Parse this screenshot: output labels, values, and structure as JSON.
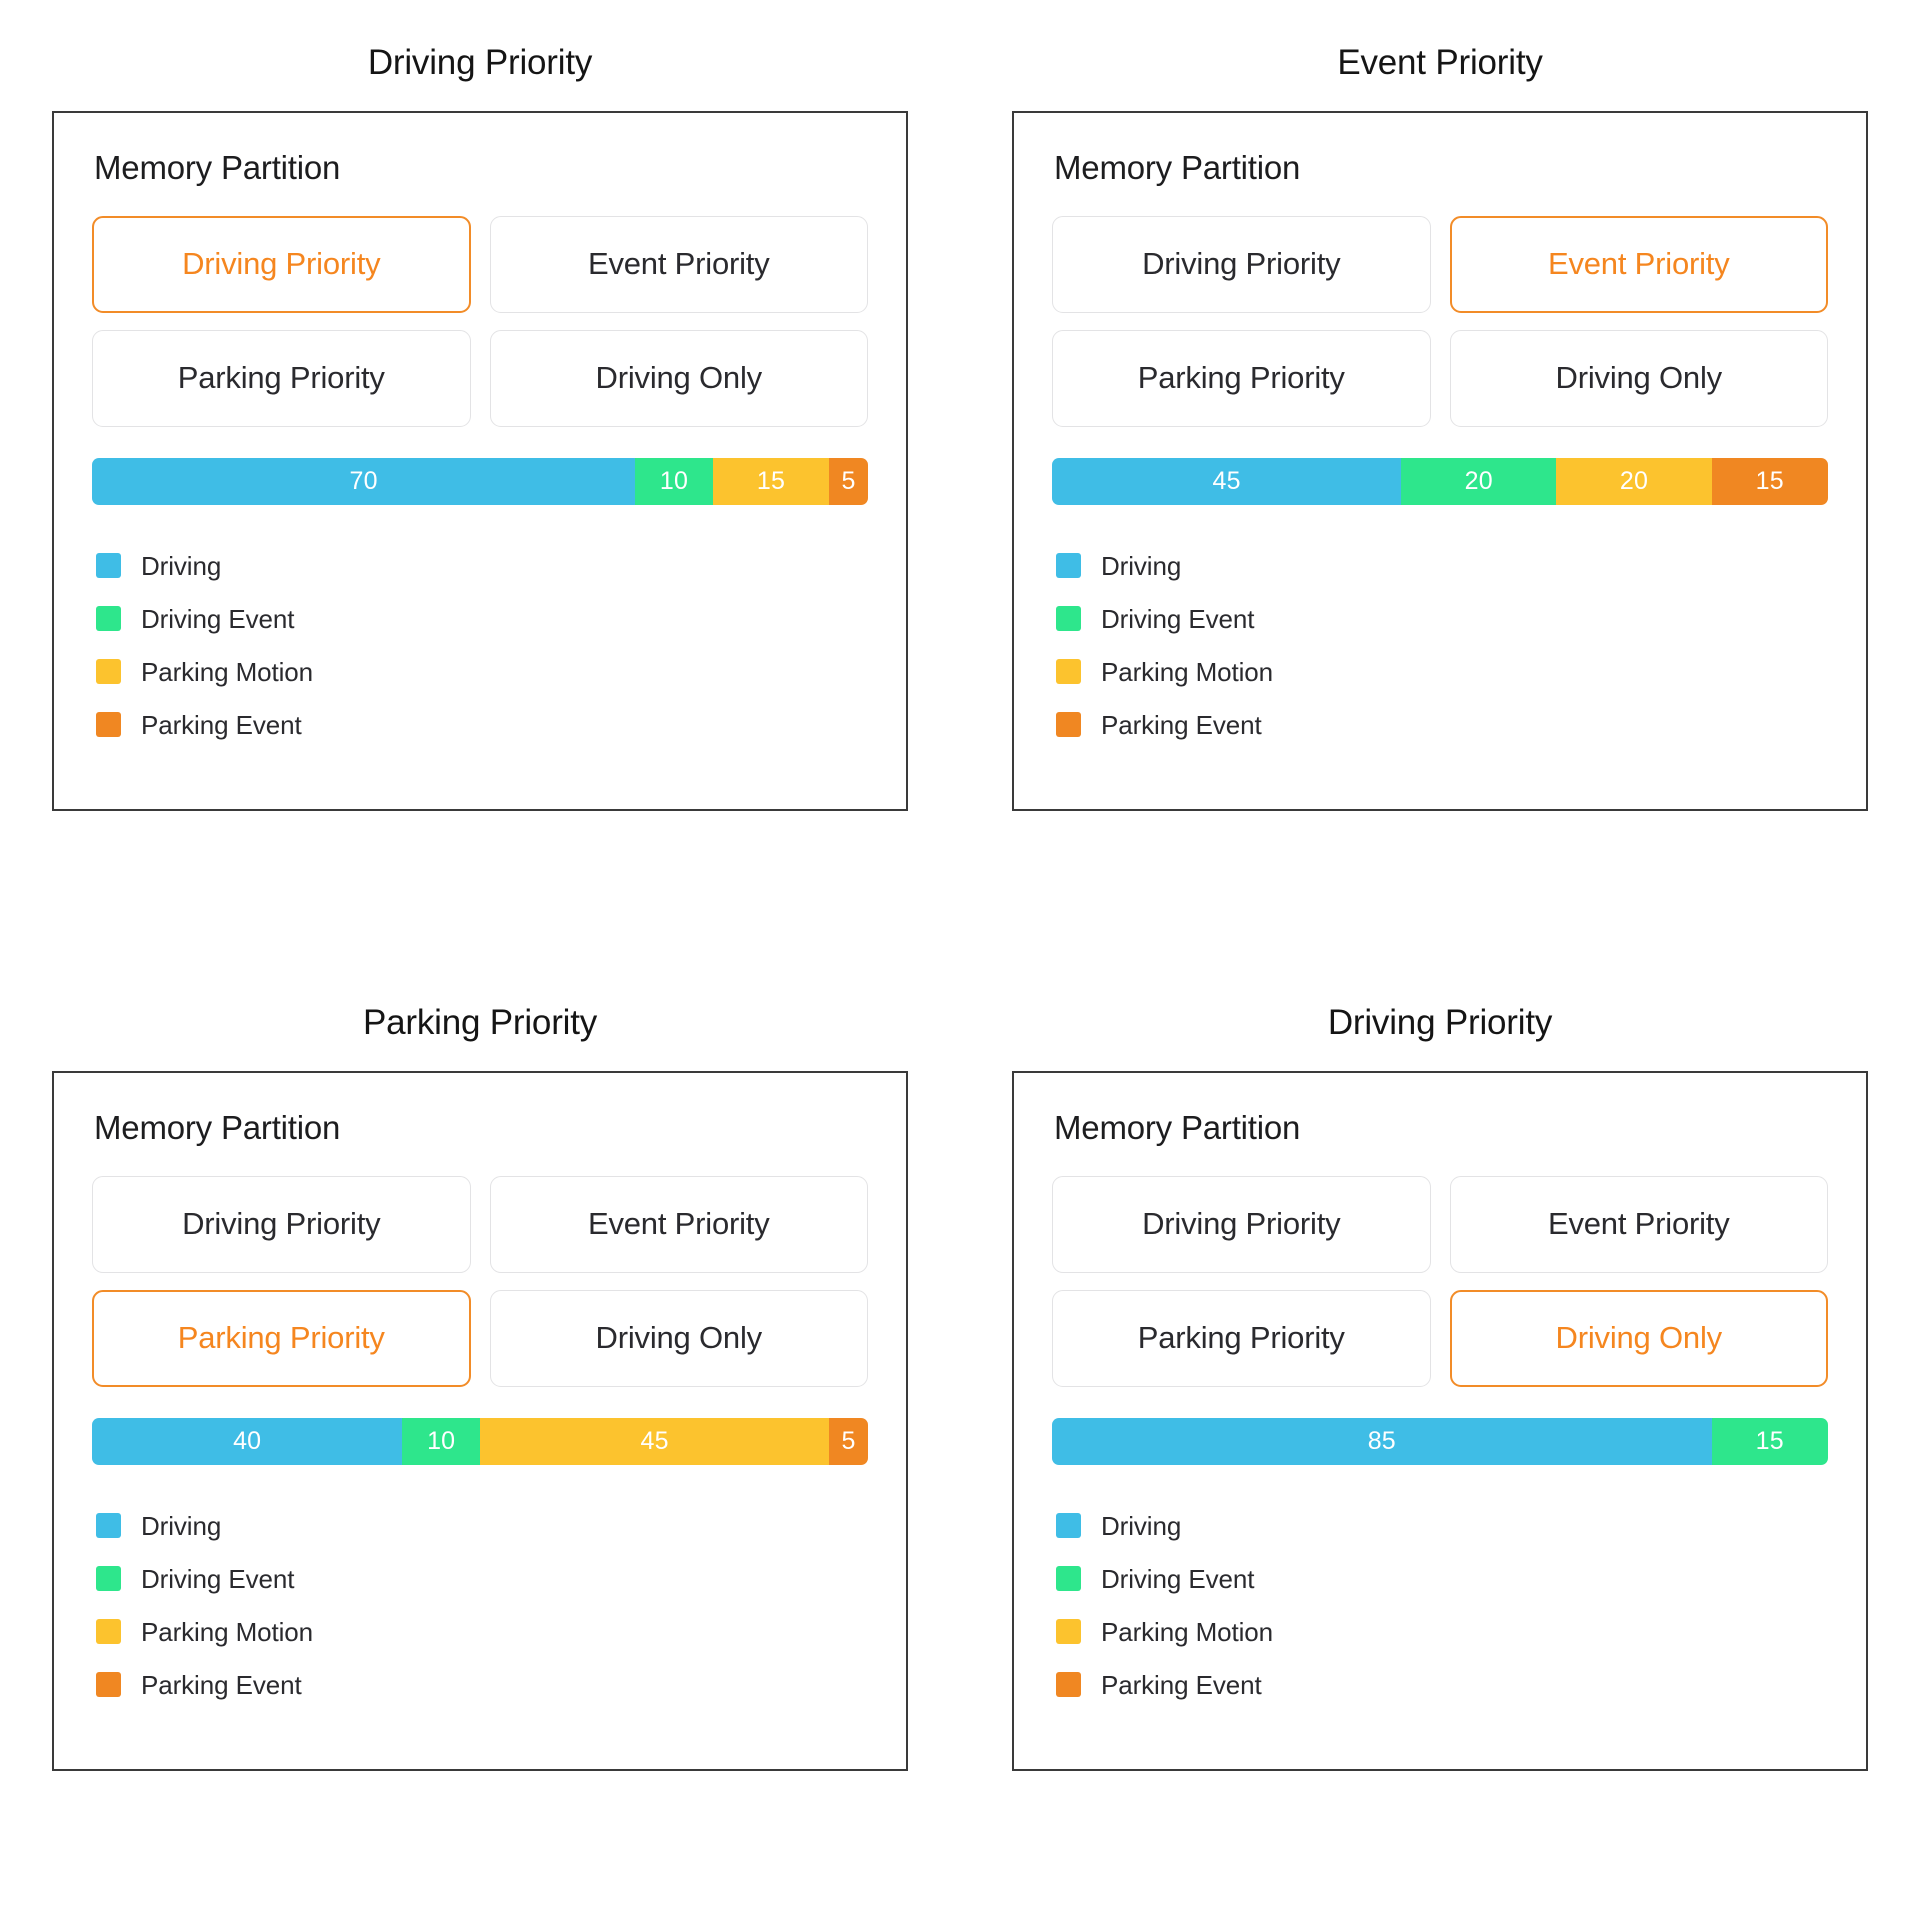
{
  "colors": {
    "driving": "#3FBDE6",
    "driving_event": "#2EE68C",
    "parking_motion": "#FCC32E",
    "parking_event": "#F08722",
    "accent_orange": "#F5861F",
    "panel_border": "#3A3A3A",
    "button_border": "#E3E3E5",
    "text": "#2A2A2E"
  },
  "legend": [
    {
      "label": "Driving",
      "color": "#3FBDE6",
      "key": "driving"
    },
    {
      "label": "Driving Event",
      "color": "#2EE68C",
      "key": "driving_event"
    },
    {
      "label": "Parking Motion",
      "color": "#FCC32E",
      "key": "parking_motion"
    },
    {
      "label": "Parking Event",
      "color": "#F08722",
      "key": "parking_event"
    }
  ],
  "panel_heading": "Memory Partition",
  "mode_buttons": [
    "Driving Priority",
    "Event Priority",
    "Parking Priority",
    "Driving Only"
  ],
  "panels": [
    {
      "title": "Driving Priority",
      "heading": "Memory Partition",
      "selected_button": "Driving Priority",
      "buttons": [
        {
          "label": "Driving Priority",
          "selected": true
        },
        {
          "label": "Event Priority",
          "selected": false
        },
        {
          "label": "Parking Priority",
          "selected": false
        },
        {
          "label": "Driving Only",
          "selected": false
        }
      ],
      "segments": [
        {
          "label": "70",
          "value": 70,
          "color": "#3FBDE6",
          "name": "Driving"
        },
        {
          "label": "10",
          "value": 10,
          "color": "#2EE68C",
          "name": "Driving Event"
        },
        {
          "label": "15",
          "value": 15,
          "color": "#FCC32E",
          "name": "Parking Motion"
        },
        {
          "label": "5",
          "value": 5,
          "color": "#F08722",
          "name": "Parking Event"
        }
      ]
    },
    {
      "title": "Event Priority",
      "heading": "Memory Partition",
      "selected_button": "Event Priority",
      "buttons": [
        {
          "label": "Driving Priority",
          "selected": false
        },
        {
          "label": "Event Priority",
          "selected": true
        },
        {
          "label": "Parking Priority",
          "selected": false
        },
        {
          "label": "Driving Only",
          "selected": false
        }
      ],
      "segments": [
        {
          "label": "45",
          "value": 45,
          "color": "#3FBDE6",
          "name": "Driving"
        },
        {
          "label": "20",
          "value": 20,
          "color": "#2EE68C",
          "name": "Driving Event"
        },
        {
          "label": "20",
          "value": 20,
          "color": "#FCC32E",
          "name": "Parking Motion"
        },
        {
          "label": "15",
          "value": 15,
          "color": "#F08722",
          "name": "Parking Event"
        }
      ]
    },
    {
      "title": "Parking Priority",
      "heading": "Memory Partition",
      "selected_button": "Parking Priority",
      "buttons": [
        {
          "label": "Driving Priority",
          "selected": false
        },
        {
          "label": "Event Priority",
          "selected": false
        },
        {
          "label": "Parking Priority",
          "selected": true
        },
        {
          "label": "Driving Only",
          "selected": false
        }
      ],
      "segments": [
        {
          "label": "40",
          "value": 40,
          "color": "#3FBDE6",
          "name": "Driving"
        },
        {
          "label": "10",
          "value": 10,
          "color": "#2EE68C",
          "name": "Driving Event"
        },
        {
          "label": "45",
          "value": 45,
          "color": "#FCC32E",
          "name": "Parking Motion"
        },
        {
          "label": "5",
          "value": 5,
          "color": "#F08722",
          "name": "Parking Event"
        }
      ]
    },
    {
      "title": "Driving Priority",
      "heading": "Memory Partition",
      "selected_button": "Driving Only",
      "buttons": [
        {
          "label": "Driving Priority",
          "selected": false
        },
        {
          "label": "Event Priority",
          "selected": false
        },
        {
          "label": "Parking Priority",
          "selected": false
        },
        {
          "label": "Driving Only",
          "selected": true
        }
      ],
      "segments": [
        {
          "label": "85",
          "value": 85,
          "color": "#3FBDE6",
          "name": "Driving"
        },
        {
          "label": "15",
          "value": 15,
          "color": "#2EE68C",
          "name": "Driving Event"
        }
      ]
    }
  ],
  "chart_data": [
    {
      "type": "bar",
      "title": "Driving Priority",
      "orientation": "horizontal-stacked",
      "categories": [
        "Driving",
        "Driving Event",
        "Parking Motion",
        "Parking Event"
      ],
      "values": [
        70,
        10,
        15,
        5
      ],
      "colors": [
        "#3FBDE6",
        "#2EE68C",
        "#FCC32E",
        "#F08722"
      ],
      "xlabel": "",
      "ylabel": "",
      "xlim": [
        0,
        100
      ],
      "grid": false,
      "legend_position": "bottom-left",
      "data_labels": true
    },
    {
      "type": "bar",
      "title": "Event Priority",
      "orientation": "horizontal-stacked",
      "categories": [
        "Driving",
        "Driving Event",
        "Parking Motion",
        "Parking Event"
      ],
      "values": [
        45,
        20,
        20,
        15
      ],
      "colors": [
        "#3FBDE6",
        "#2EE68C",
        "#FCC32E",
        "#F08722"
      ],
      "xlabel": "",
      "ylabel": "",
      "xlim": [
        0,
        100
      ],
      "grid": false,
      "legend_position": "bottom-left",
      "data_labels": true
    },
    {
      "type": "bar",
      "title": "Parking Priority",
      "orientation": "horizontal-stacked",
      "categories": [
        "Driving",
        "Driving Event",
        "Parking Motion",
        "Parking Event"
      ],
      "values": [
        40,
        10,
        45,
        5
      ],
      "colors": [
        "#3FBDE6",
        "#2EE68C",
        "#FCC32E",
        "#F08722"
      ],
      "xlabel": "",
      "ylabel": "",
      "xlim": [
        0,
        100
      ],
      "grid": false,
      "legend_position": "bottom-left",
      "data_labels": true
    },
    {
      "type": "bar",
      "title": "Driving Priority",
      "orientation": "horizontal-stacked",
      "categories": [
        "Driving",
        "Driving Event"
      ],
      "values": [
        85,
        15
      ],
      "colors": [
        "#3FBDE6",
        "#2EE68C"
      ],
      "xlabel": "",
      "ylabel": "",
      "xlim": [
        0,
        100
      ],
      "grid": false,
      "legend_position": "bottom-left",
      "data_labels": true
    }
  ]
}
